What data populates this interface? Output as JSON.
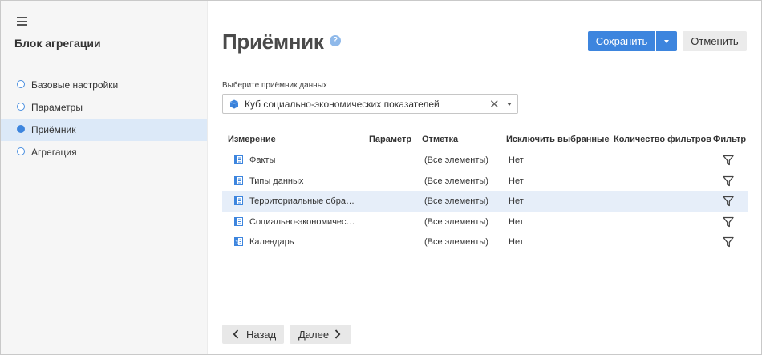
{
  "sidebar": {
    "title": "Блок агрегации",
    "steps": [
      {
        "label": "Базовые настройки",
        "active": false
      },
      {
        "label": "Параметры",
        "active": false
      },
      {
        "label": "Приёмник",
        "active": true
      },
      {
        "label": "Агрегация",
        "active": false
      }
    ]
  },
  "header": {
    "title": "Приёмник",
    "help": "?",
    "save_label": "Сохранить",
    "cancel_label": "Отменить"
  },
  "receiver": {
    "label": "Выберите приёмник данных",
    "value": "Куб социально-экономических показателей",
    "clear": "✕"
  },
  "table": {
    "columns": [
      "Измерение",
      "Параметр",
      "Отметка",
      "Исключить выбранные",
      "Количество фильтров",
      "Фильтр"
    ],
    "rows": [
      {
        "dimension": "Факты",
        "parameter": "",
        "mark": "(Все элементы)",
        "exclude": "Нет",
        "filters": "",
        "icon": "facts-icon",
        "selected": false
      },
      {
        "dimension": "Типы данных",
        "parameter": "",
        "mark": "(Все элементы)",
        "exclude": "Нет",
        "filters": "",
        "icon": "dictionary-icon",
        "selected": false
      },
      {
        "dimension": "Территориальные обра…",
        "parameter": "",
        "mark": "(Все элементы)",
        "exclude": "Нет",
        "filters": "",
        "icon": "dictionary-icon",
        "selected": true
      },
      {
        "dimension": "Социально-экономичес…",
        "parameter": "",
        "mark": "(Все элементы)",
        "exclude": "Нет",
        "filters": "",
        "icon": "dictionary-icon",
        "selected": false
      },
      {
        "dimension": "Календарь",
        "parameter": "",
        "mark": "(Все элементы)",
        "exclude": "Нет",
        "filters": "",
        "icon": "calendar-icon",
        "selected": false
      }
    ]
  },
  "nav": {
    "back_label": "Назад",
    "next_label": "Далее"
  },
  "colors": {
    "accent": "#3d85de",
    "sidebar_bg": "#f6f6f6",
    "active_step_bg": "#dce9f8",
    "selected_row_bg": "#e6eef9"
  }
}
